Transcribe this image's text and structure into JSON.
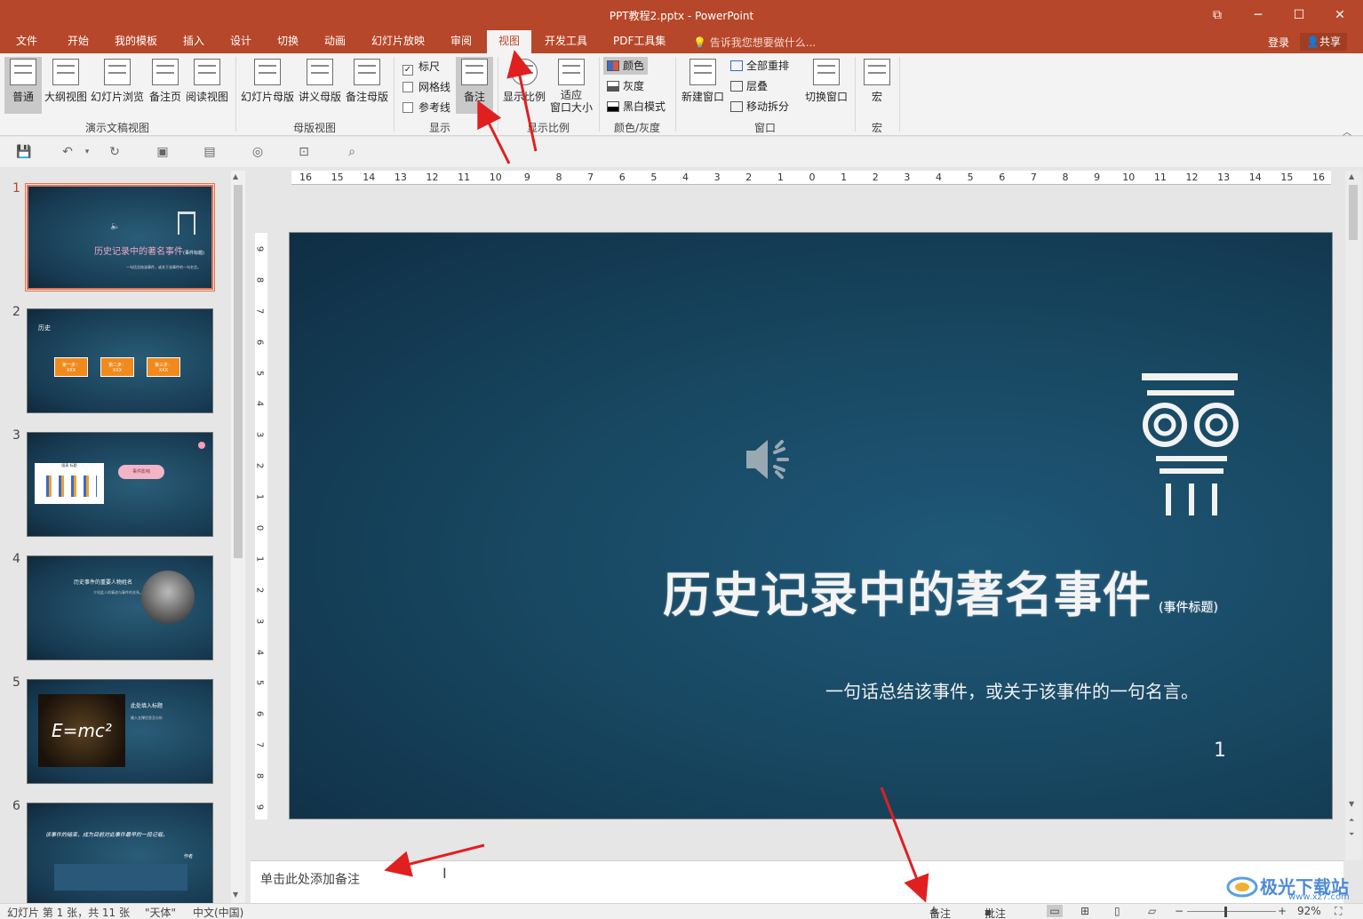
{
  "window": {
    "title": "PPT教程2.pptx - PowerPoint",
    "controls": {
      "restore": "⧉",
      "minimize": "─",
      "maximize": "☐",
      "close": "✕"
    }
  },
  "tabs": [
    {
      "label": "文件"
    },
    {
      "label": "开始"
    },
    {
      "label": "我的模板"
    },
    {
      "label": "插入"
    },
    {
      "label": "设计"
    },
    {
      "label": "切换"
    },
    {
      "label": "动画"
    },
    {
      "label": "幻灯片放映"
    },
    {
      "label": "审阅"
    },
    {
      "label": "视图"
    },
    {
      "label": "开发工具"
    },
    {
      "label": "PDF工具集"
    }
  ],
  "tell_me": "告诉我您想要做什么...",
  "login": "登录",
  "share": "共享",
  "ribbon": {
    "presentation_views": {
      "label": "演示文稿视图",
      "buttons": [
        "普通",
        "大纲视图",
        "幻灯片浏览",
        "备注页",
        "阅读视图"
      ]
    },
    "master_views": {
      "label": "母版视图",
      "buttons": [
        "幻灯片母版",
        "讲义母版",
        "备注母版"
      ]
    },
    "show": {
      "label": "显示",
      "ruler": "标尺",
      "gridlines": "网格线",
      "guides": "参考线",
      "notes": "备注"
    },
    "zoom": {
      "label": "显示比例",
      "zoom": "显示比例",
      "fit_line1": "适应",
      "fit_line2": "窗口大小"
    },
    "color": {
      "label": "颜色/灰度",
      "color": "颜色",
      "grayscale": "灰度",
      "bw": "黑白模式"
    },
    "window": {
      "label": "窗口",
      "new_window": "新建窗口",
      "arrange_all": "全部重排",
      "cascade": "层叠",
      "move_split": "移动拆分",
      "switch_windows": "切换窗口"
    },
    "macros": {
      "label": "宏",
      "macro": "宏"
    }
  },
  "ruler": {
    "h_ticks": [
      "16",
      "15",
      "14",
      "13",
      "12",
      "11",
      "10",
      "9",
      "8",
      "7",
      "6",
      "5",
      "4",
      "3",
      "2",
      "1",
      "0",
      "1",
      "2",
      "3",
      "4",
      "5",
      "6",
      "7",
      "8",
      "9",
      "10",
      "11",
      "12",
      "13",
      "14",
      "15",
      "16"
    ],
    "v_ticks": [
      "9",
      "8",
      "7",
      "6",
      "5",
      "4",
      "3",
      "2",
      "1",
      "0",
      "1",
      "2",
      "3",
      "4",
      "5",
      "6",
      "7",
      "8",
      "9"
    ]
  },
  "thumbnails": [
    {
      "num": "1",
      "title": "历史记录中的著名事件",
      "tag": "(事件标题)",
      "sub": "一句话总结该事件，或关于该事件的一句名言。"
    },
    {
      "num": "2",
      "title": "历史",
      "steps": [
        "第一步：",
        "第二步：",
        "第三步："
      ],
      "step_sub": "XXX"
    },
    {
      "num": "3",
      "bubble": "事件影响",
      "chart_title": "图表 标题"
    },
    {
      "num": "4",
      "title": "历史事件的重要人物姓名",
      "sub": "介绍此人的事迹与事件的关系。"
    },
    {
      "num": "5",
      "title": "此处填入标题",
      "formula": "E=mc²",
      "sub": "输入支撑信息及分析"
    },
    {
      "num": "6",
      "quote": "该事件的结束，成为目前对此事件最早的一段记载。",
      "author": "作者"
    }
  ],
  "slide": {
    "title": "历史记录中的著名事件",
    "title_note": "(事件标题)",
    "subtitle": "一句话总结该事件，或关于该事件的一句名言。",
    "number": "1"
  },
  "notes": {
    "placeholder": "单击此处添加备注"
  },
  "status": {
    "slide_info": "幻灯片 第 1 张，共 11 张",
    "theme": "\"天体\"",
    "language": "中文(中国)",
    "notes": "备注",
    "comments": "批注",
    "zoom": "92%"
  },
  "watermark": {
    "text": "极光下载站",
    "sub": "www.xz7.com"
  },
  "colors": {
    "accent": "#b7472a",
    "slide_bg": "#184862",
    "arrow": "#e02020",
    "selection": "#e1744f"
  }
}
